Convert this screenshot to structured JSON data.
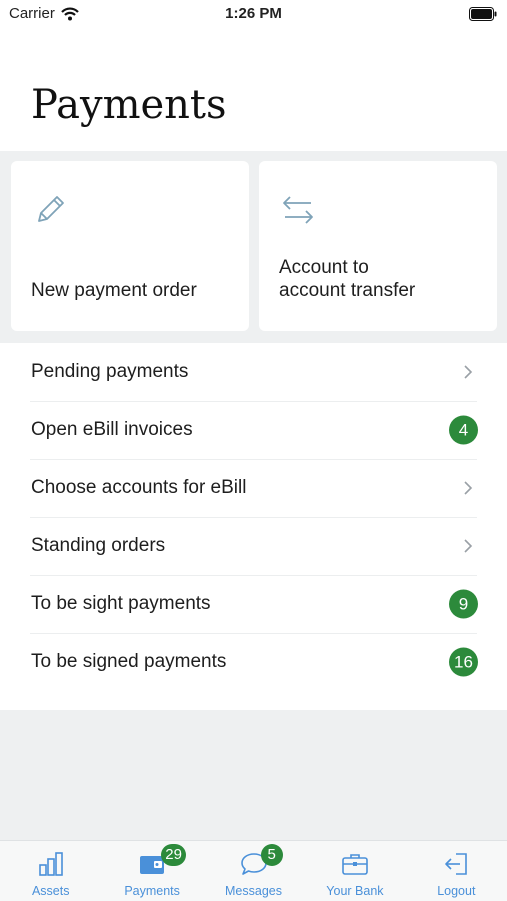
{
  "status_bar": {
    "carrier": "Carrier",
    "time": "1:26 PM"
  },
  "title": "Payments",
  "cards": [
    {
      "label": "New payment order",
      "icon": "pencil-icon"
    },
    {
      "label": "Account to\naccount transfer",
      "icon": "transfer-arrows-icon"
    }
  ],
  "list": {
    "items": [
      {
        "label": "Pending payments",
        "badge": null
      },
      {
        "label": "Open eBill invoices",
        "badge": "4"
      },
      {
        "label": "Choose accounts for eBill",
        "badge": null
      },
      {
        "label": "Standing orders",
        "badge": null
      },
      {
        "label": "To be sight payments",
        "badge": "9"
      },
      {
        "label": "To be signed payments",
        "badge": "16"
      }
    ]
  },
  "tabs": [
    {
      "label": "Assets",
      "icon": "bar-chart-icon",
      "badge": null
    },
    {
      "label": "Payments",
      "icon": "wallet-icon",
      "badge": "29"
    },
    {
      "label": "Messages",
      "icon": "chat-bubble-icon",
      "badge": "5"
    },
    {
      "label": "Your Bank",
      "icon": "briefcase-icon",
      "badge": null
    },
    {
      "label": "Logout",
      "icon": "logout-icon",
      "badge": null
    }
  ],
  "colors": {
    "accent": "#4a90d9",
    "badge": "#2c8a3b",
    "background_gray": "#eef0f1"
  }
}
